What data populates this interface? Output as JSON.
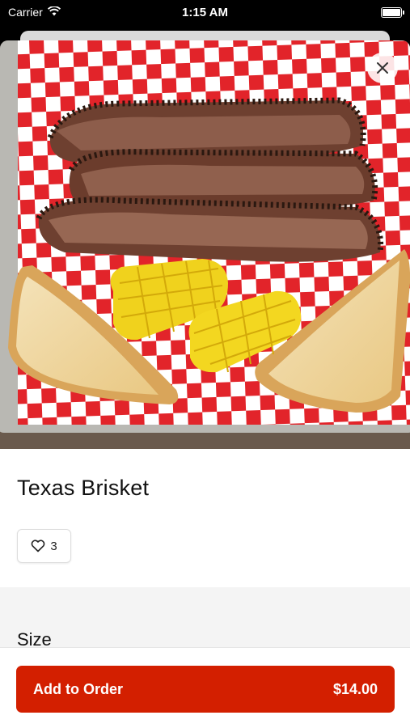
{
  "status_bar": {
    "carrier": "Carrier",
    "time": "1:15 AM"
  },
  "item": {
    "title": "Texas Brisket",
    "likes": "3"
  },
  "options": {
    "size_label": "Size"
  },
  "footer": {
    "add_label": "Add to Order",
    "price": "$14.00"
  },
  "colors": {
    "accent": "#d31f00",
    "checker_red": "#e2242a"
  },
  "icons": {
    "close": "close-icon",
    "heart": "heart-icon",
    "wifi": "wifi-icon",
    "battery": "battery-icon"
  }
}
